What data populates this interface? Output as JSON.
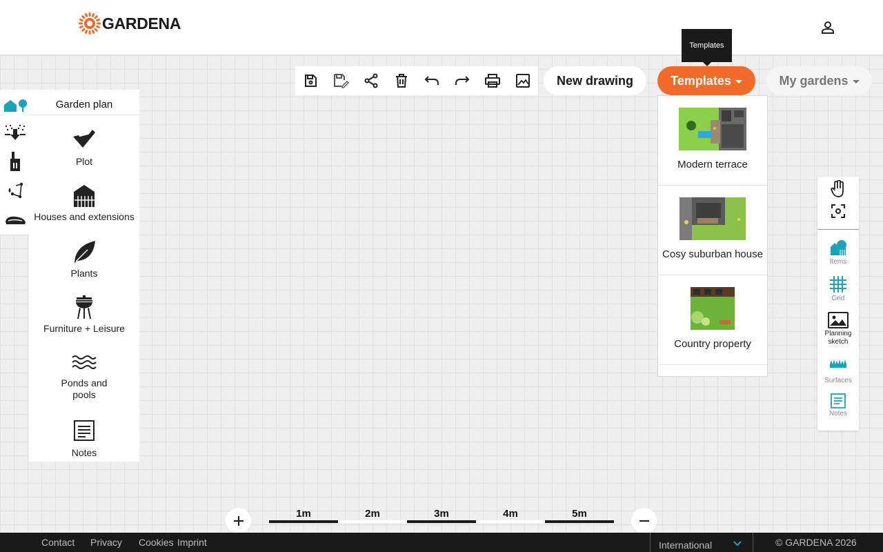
{
  "header": {
    "brand": "GARDENA",
    "brand_color": "#f36b2b",
    "user_icon": "user-icon"
  },
  "toolbar": {
    "tools": [
      "save-icon",
      "save-as-icon",
      "share-icon",
      "delete-icon",
      "undo-icon",
      "redo-icon",
      "print-icon",
      "image-icon"
    ]
  },
  "actions": {
    "new_drawing": "New drawing",
    "templates": "Templates",
    "my_gardens": "My gardens",
    "templates_tooltip": "Templates",
    "accent_color": "#f36b2b"
  },
  "templates_menu": {
    "items": [
      {
        "label": "Modern terrace"
      },
      {
        "label": "Cosy suburban house"
      },
      {
        "label": "Country property"
      }
    ]
  },
  "left_strip": {
    "icons": [
      "garden-plan-icon",
      "irrigation-icon",
      "water-pump-icon",
      "pipe-network-icon",
      "robotic-mower-icon"
    ]
  },
  "left_panel": {
    "title": "Garden plan",
    "categories": [
      {
        "label": "Plot",
        "icon": "plot-icon"
      },
      {
        "label": "Houses and extensions",
        "icon": "house-icon"
      },
      {
        "label": "Plants",
        "icon": "leaf-icon"
      },
      {
        "label": "Furniture + Leisure",
        "icon": "grill-icon"
      },
      {
        "label": "Ponds and\npools",
        "icon": "waves-icon"
      },
      {
        "label": "Notes",
        "icon": "notes-icon"
      }
    ]
  },
  "right_panel": {
    "tools": [
      {
        "label": "Items",
        "icon": "items-icon"
      },
      {
        "label": "Grid",
        "icon": "grid-icon"
      },
      {
        "label": "Planning sketch",
        "icon": "planning-sketch-icon"
      },
      {
        "label": "Surfaces",
        "icon": "surfaces-icon"
      },
      {
        "label": "Notes",
        "icon": "notes-icon"
      }
    ],
    "active_color": "#1aa3b8"
  },
  "scale": {
    "labels": [
      "1m",
      "2m",
      "3m",
      "4m",
      "5m"
    ]
  },
  "footer": {
    "links": [
      "Contact",
      "Privacy",
      "Cookies",
      "Imprint"
    ],
    "region": "International",
    "copyright": "© GARDENA 2026"
  }
}
